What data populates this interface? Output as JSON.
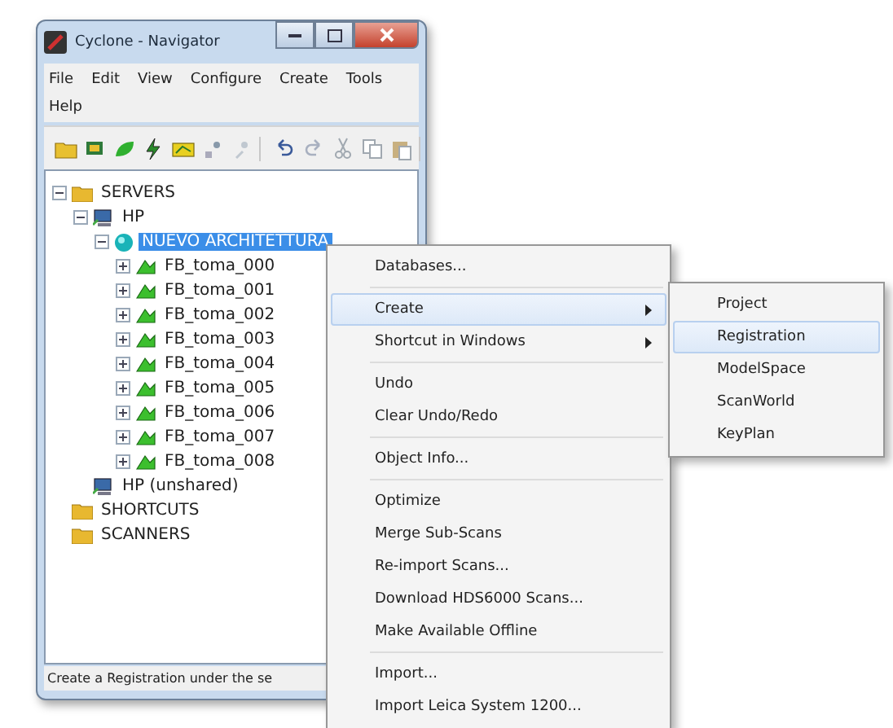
{
  "window": {
    "title": "Cyclone - Navigator"
  },
  "menu_bar_rows": [
    [
      "File",
      "Edit",
      "View",
      "Configure",
      "Create",
      "Tools"
    ],
    [
      "Help"
    ]
  ],
  "toolbar": {
    "groups": [
      [
        {
          "kind": "folder"
        },
        {
          "kind": "server"
        },
        {
          "kind": "scan"
        },
        {
          "kind": "link"
        },
        {
          "kind": "database"
        },
        {
          "kind": "user"
        },
        {
          "kind": "user-disabled"
        }
      ],
      [
        {
          "kind": "undo"
        },
        {
          "kind": "redo"
        },
        {
          "kind": "cut"
        },
        {
          "kind": "copy"
        },
        {
          "kind": "paste"
        }
      ]
    ]
  },
  "tree": [
    {
      "label": "SERVERS",
      "kind": "folder",
      "expanded": true,
      "selected": false,
      "children": [
        {
          "label": "HP",
          "kind": "server",
          "expanded": true,
          "selected": false,
          "children": [
            {
              "label": "NUEVO ARCHITETTURA",
              "kind": "database",
              "expanded": true,
              "selected": true,
              "children": [
                {
                  "label": "FB_toma_000",
                  "kind": "scan",
                  "expanded": false,
                  "selected": false
                },
                {
                  "label": "FB_toma_001",
                  "kind": "scan",
                  "expanded": false,
                  "selected": false
                },
                {
                  "label": "FB_toma_002",
                  "kind": "scan",
                  "expanded": false,
                  "selected": false
                },
                {
                  "label": "FB_toma_003",
                  "kind": "scan",
                  "expanded": false,
                  "selected": false
                },
                {
                  "label": "FB_toma_004",
                  "kind": "scan",
                  "expanded": false,
                  "selected": false
                },
                {
                  "label": "FB_toma_005",
                  "kind": "scan",
                  "expanded": false,
                  "selected": false
                },
                {
                  "label": "FB_toma_006",
                  "kind": "scan",
                  "expanded": false,
                  "selected": false
                },
                {
                  "label": "FB_toma_007",
                  "kind": "scan",
                  "expanded": false,
                  "selected": false
                },
                {
                  "label": "FB_toma_008",
                  "kind": "scan",
                  "expanded": false,
                  "selected": false
                }
              ]
            }
          ]
        },
        {
          "label": "HP (unshared)",
          "kind": "server",
          "selected": false
        }
      ]
    },
    {
      "label": "SHORTCUTS",
      "kind": "folder",
      "selected": false
    },
    {
      "label": "SCANNERS",
      "kind": "folder",
      "selected": false
    }
  ],
  "status_bar": "Create a Registration under the se",
  "context_menu": {
    "groups": [
      [
        {
          "label": "Databases...",
          "selected": false
        }
      ],
      [
        {
          "label": "Create",
          "selected": true,
          "submenu": true
        },
        {
          "label": "Shortcut in Windows",
          "selected": false,
          "submenu": true
        }
      ],
      [
        {
          "label": "Undo",
          "selected": false
        },
        {
          "label": "Clear Undo/Redo",
          "selected": false
        }
      ],
      [
        {
          "label": "Object Info...",
          "selected": false
        }
      ],
      [
        {
          "label": "Optimize",
          "selected": false
        },
        {
          "label": "Merge Sub-Scans",
          "selected": false
        },
        {
          "label": "Re-import Scans...",
          "selected": false
        },
        {
          "label": "Download HDS6000 Scans...",
          "selected": false
        },
        {
          "label": "Make Available Offline",
          "selected": false
        }
      ],
      [
        {
          "label": "Import...",
          "selected": false
        },
        {
          "label": "Import Leica System 1200...",
          "selected": false
        }
      ]
    ]
  },
  "submenu": {
    "items": [
      {
        "label": "Project",
        "selected": false
      },
      {
        "label": "Registration",
        "selected": true
      },
      {
        "label": "ModelSpace",
        "selected": false
      },
      {
        "label": "ScanWorld",
        "selected": false
      },
      {
        "label": "KeyPlan",
        "selected": false
      }
    ]
  }
}
